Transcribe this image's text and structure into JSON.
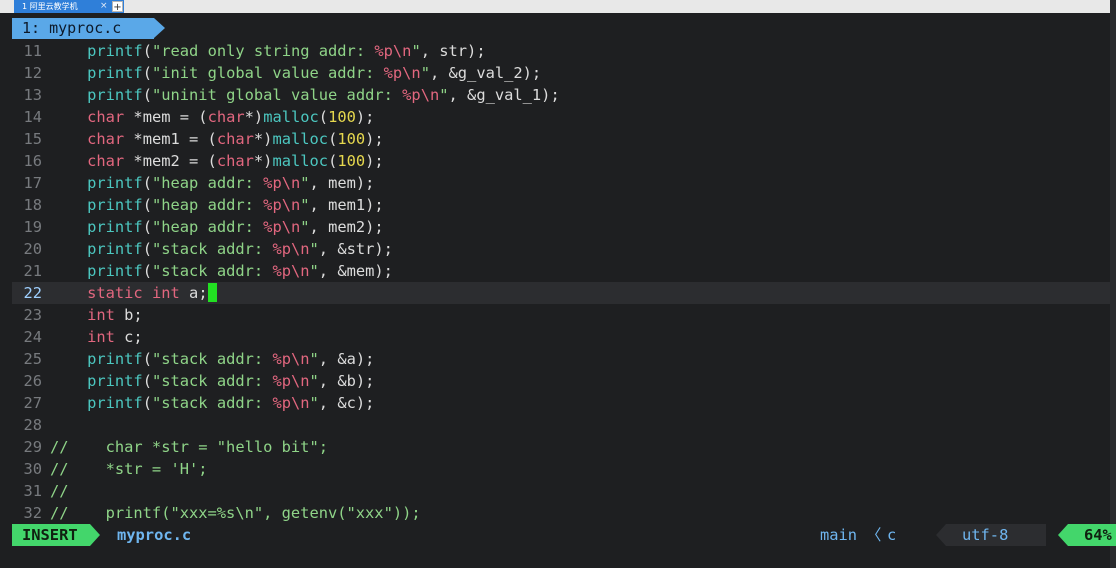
{
  "window": {
    "tab_title": "1 阿里云教学机",
    "close_glyph": "×",
    "add_glyph": "+"
  },
  "tabline": {
    "active_tab": "1: myproc.c"
  },
  "lines": [
    {
      "n": "11",
      "segs": [
        [
          "",
          "    "
        ],
        [
          "fn",
          "printf"
        ],
        [
          "txt",
          "("
        ],
        [
          "str",
          "\"read only string addr: "
        ],
        [
          "fmt",
          "%p\\n"
        ],
        [
          "str",
          "\""
        ],
        [
          "txt",
          ", str);"
        ]
      ]
    },
    {
      "n": "12",
      "segs": [
        [
          "",
          "    "
        ],
        [
          "fn",
          "printf"
        ],
        [
          "txt",
          "("
        ],
        [
          "str",
          "\"init global value addr: "
        ],
        [
          "fmt",
          "%p\\n"
        ],
        [
          "str",
          "\""
        ],
        [
          "txt",
          ", &g_val_2);"
        ]
      ]
    },
    {
      "n": "13",
      "segs": [
        [
          "",
          "    "
        ],
        [
          "fn",
          "printf"
        ],
        [
          "txt",
          "("
        ],
        [
          "str",
          "\"uninit global value addr: "
        ],
        [
          "fmt",
          "%p\\n"
        ],
        [
          "str",
          "\""
        ],
        [
          "txt",
          ", &g_val_1);"
        ]
      ]
    },
    {
      "n": "14",
      "segs": [
        [
          "",
          "    "
        ],
        [
          "kw",
          "char"
        ],
        [
          "txt",
          " *mem = ("
        ],
        [
          "kw",
          "char"
        ],
        [
          "txt",
          "*)"
        ],
        [
          "fn",
          "malloc"
        ],
        [
          "txt",
          "("
        ],
        [
          "num",
          "100"
        ],
        [
          "txt",
          ");"
        ]
      ]
    },
    {
      "n": "15",
      "segs": [
        [
          "",
          "    "
        ],
        [
          "kw",
          "char"
        ],
        [
          "txt",
          " *mem1 = ("
        ],
        [
          "kw",
          "char"
        ],
        [
          "txt",
          "*)"
        ],
        [
          "fn",
          "malloc"
        ],
        [
          "txt",
          "("
        ],
        [
          "num",
          "100"
        ],
        [
          "txt",
          ");"
        ]
      ]
    },
    {
      "n": "16",
      "segs": [
        [
          "",
          "    "
        ],
        [
          "kw",
          "char"
        ],
        [
          "txt",
          " *mem2 = ("
        ],
        [
          "kw",
          "char"
        ],
        [
          "txt",
          "*)"
        ],
        [
          "fn",
          "malloc"
        ],
        [
          "txt",
          "("
        ],
        [
          "num",
          "100"
        ],
        [
          "txt",
          ");"
        ]
      ]
    },
    {
      "n": "17",
      "segs": [
        [
          "",
          "    "
        ],
        [
          "fn",
          "printf"
        ],
        [
          "txt",
          "("
        ],
        [
          "str",
          "\"heap addr: "
        ],
        [
          "fmt",
          "%p\\n"
        ],
        [
          "str",
          "\""
        ],
        [
          "txt",
          ", mem);"
        ]
      ]
    },
    {
      "n": "18",
      "segs": [
        [
          "",
          "    "
        ],
        [
          "fn",
          "printf"
        ],
        [
          "txt",
          "("
        ],
        [
          "str",
          "\"heap addr: "
        ],
        [
          "fmt",
          "%p\\n"
        ],
        [
          "str",
          "\""
        ],
        [
          "txt",
          ", mem1);"
        ]
      ]
    },
    {
      "n": "19",
      "segs": [
        [
          "",
          "    "
        ],
        [
          "fn",
          "printf"
        ],
        [
          "txt",
          "("
        ],
        [
          "str",
          "\"heap addr: "
        ],
        [
          "fmt",
          "%p\\n"
        ],
        [
          "str",
          "\""
        ],
        [
          "txt",
          ", mem2);"
        ]
      ]
    },
    {
      "n": "20",
      "segs": [
        [
          "",
          "    "
        ],
        [
          "fn",
          "printf"
        ],
        [
          "txt",
          "("
        ],
        [
          "str",
          "\"stack addr: "
        ],
        [
          "fmt",
          "%p\\n"
        ],
        [
          "str",
          "\""
        ],
        [
          "txt",
          ", &str);"
        ]
      ]
    },
    {
      "n": "21",
      "segs": [
        [
          "",
          "    "
        ],
        [
          "fn",
          "printf"
        ],
        [
          "txt",
          "("
        ],
        [
          "str",
          "\"stack addr: "
        ],
        [
          "fmt",
          "%p\\n"
        ],
        [
          "str",
          "\""
        ],
        [
          "txt",
          ", &mem);"
        ]
      ]
    },
    {
      "n": "22",
      "current": true,
      "segs": [
        [
          "",
          "    "
        ],
        [
          "kw",
          "static"
        ],
        [
          "txt",
          " "
        ],
        [
          "kw",
          "int"
        ],
        [
          "txt",
          " a;"
        ]
      ]
    },
    {
      "n": "23",
      "segs": [
        [
          "",
          "    "
        ],
        [
          "kw",
          "int"
        ],
        [
          "txt",
          " b;"
        ]
      ]
    },
    {
      "n": "24",
      "segs": [
        [
          "",
          "    "
        ],
        [
          "kw",
          "int"
        ],
        [
          "txt",
          " c;"
        ]
      ]
    },
    {
      "n": "25",
      "segs": [
        [
          "",
          "    "
        ],
        [
          "fn",
          "printf"
        ],
        [
          "txt",
          "("
        ],
        [
          "str",
          "\"stack addr: "
        ],
        [
          "fmt",
          "%p\\n"
        ],
        [
          "str",
          "\""
        ],
        [
          "txt",
          ", &a);"
        ]
      ]
    },
    {
      "n": "26",
      "segs": [
        [
          "",
          "    "
        ],
        [
          "fn",
          "printf"
        ],
        [
          "txt",
          "("
        ],
        [
          "str",
          "\"stack addr: "
        ],
        [
          "fmt",
          "%p\\n"
        ],
        [
          "str",
          "\""
        ],
        [
          "txt",
          ", &b);"
        ]
      ]
    },
    {
      "n": "27",
      "segs": [
        [
          "",
          "    "
        ],
        [
          "fn",
          "printf"
        ],
        [
          "txt",
          "("
        ],
        [
          "str",
          "\"stack addr: "
        ],
        [
          "fmt",
          "%p\\n"
        ],
        [
          "str",
          "\""
        ],
        [
          "txt",
          ", &c);"
        ]
      ]
    },
    {
      "n": "28",
      "segs": []
    },
    {
      "n": "29",
      "segs": [
        [
          "cmt",
          "//    char *str = \"hello bit\";"
        ]
      ]
    },
    {
      "n": "30",
      "segs": [
        [
          "cmt",
          "//    *str = 'H';"
        ]
      ]
    },
    {
      "n": "31",
      "segs": [
        [
          "cmt",
          "//"
        ]
      ]
    },
    {
      "n": "32",
      "segs": [
        [
          "cmt",
          "//    printf(\"xxx=%s\\n\", getenv(\"xxx\"));"
        ]
      ]
    }
  ],
  "statusline": {
    "mode": "INSERT",
    "filename": "myproc.c",
    "branch": "main",
    "separator": "〈",
    "filetype": "c",
    "encoding": "utf-8",
    "percent": "64%"
  },
  "colors": {
    "background": "#1e1f21",
    "function": "#4cc7c0",
    "string": "#8fd488",
    "keyword": "#e2677f",
    "number": "#e6d84e",
    "mode_bg": "#43d66b",
    "tab_bg": "#5aa8e8",
    "cursor": "#22e022"
  }
}
